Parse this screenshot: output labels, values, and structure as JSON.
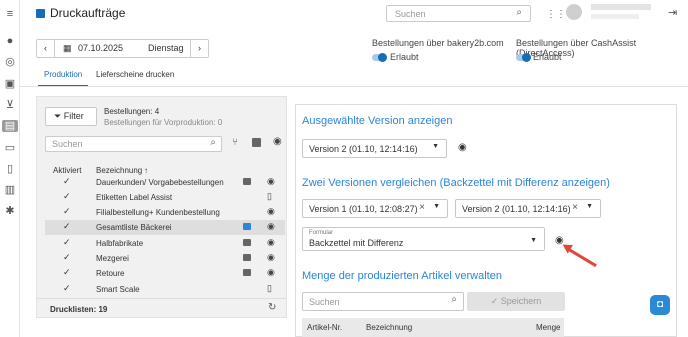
{
  "header": {
    "title": "Druckaufträge",
    "search_placeholder": "Suchen"
  },
  "date": {
    "value": "07.10.2025",
    "weekday": "Dienstag",
    "prev": "‹",
    "next": "›"
  },
  "orders": {
    "bakery_label": "Bestellungen über bakery2b.com",
    "bakery_value": "Erlaubt",
    "cashassist_label": "Bestellungen über CashAssist (DirectAccess)",
    "cashassist_value": "Erlaubt"
  },
  "tabs": [
    {
      "label": "Produktion"
    },
    {
      "label": "Lieferscheine drucken"
    }
  ],
  "left": {
    "filter_label": "Filter",
    "orders_count": "Bestellungen: 4",
    "preprod": "Bestellungen für Vorproduktion: 0",
    "search_placeholder": "Suchen",
    "col_active": "Aktiviert",
    "col_name": "Bezeichnung",
    "rows": [
      {
        "name": "Dauerkunden/ Vorgabebestellungen"
      },
      {
        "name": "Etiketten Label Assist"
      },
      {
        "name": "Filialbestellung+ Kundenbestellung"
      },
      {
        "name": "Gesamtliste Bäckerei"
      },
      {
        "name": "Halbfabrikate"
      },
      {
        "name": "Mezgerei"
      },
      {
        "name": "Retoure"
      },
      {
        "name": "Smart Scale"
      }
    ],
    "druck_label": "Drucklisten: 19"
  },
  "right": {
    "section1_title": "Ausgewählte Version anzeigen",
    "version_selected": "Version 2 (01.10, 12:14:16)",
    "section2_title": "Zwei Versionen vergleichen (Backzettel mit Differenz anzeigen)",
    "compare_a": "Version 1 (01.10, 12:08:27)",
    "compare_b": "Version 2 (01.10, 12:14:16)",
    "formular_label": "Formular",
    "formular_value": "Backzettel mit Differenz",
    "section3_title": "Menge der produzierten Artikel verwalten",
    "search_placeholder": "Suchen",
    "save_label": "Speichern",
    "col_article": "Artikel-Nr.",
    "col_name": "Bezeichnung",
    "col_qty": "Menge"
  },
  "colors": {
    "accent": "#1a6bb5",
    "heading": "#2a86d9",
    "annotation_arrow": "#e0463a"
  }
}
